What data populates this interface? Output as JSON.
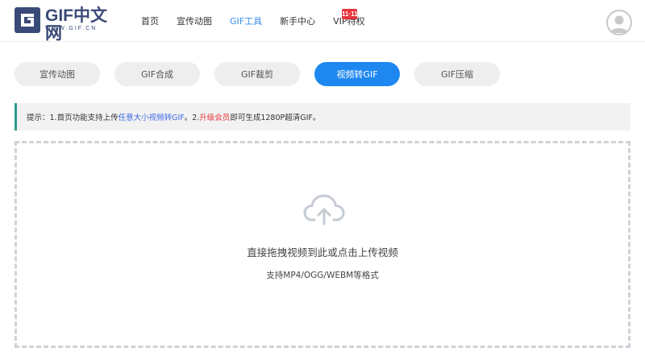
{
  "logo": {
    "text": "GIF中文网",
    "subtext": "WWW.GIF.CN"
  },
  "nav": {
    "items": [
      {
        "label": "首页"
      },
      {
        "label": "宣传动图"
      },
      {
        "label": "GIF工具"
      },
      {
        "label": "新手中心"
      },
      {
        "label": "VIP特权"
      }
    ],
    "active": "GIF工具",
    "badge": "11·11"
  },
  "tabs": [
    {
      "label": "宣传动图"
    },
    {
      "label": "GIF合成"
    },
    {
      "label": "GIF裁剪"
    },
    {
      "label": "视频转GIF"
    },
    {
      "label": "GIF压缩"
    }
  ],
  "notice": {
    "part1": "提示：1.首页功能支持上传",
    "highlight1": "任意大小视频转GIF",
    "part2": "。2.",
    "highlight2": "升级会员",
    "part3": "即可生成1280P超清GIF。"
  },
  "upload": {
    "title": "直接拖拽视频到此或点击上传视频",
    "formats": "支持MP4/OGG/WEBM等格式"
  },
  "colors": {
    "accent": "#1e88f0",
    "nav_active": "#3c8df0",
    "badge": "#e8333b",
    "notice_border": "#2a9d8a",
    "logo": "#3a4a78"
  },
  "icons": {
    "logo": "gif-logo-icon",
    "avatar": "user-avatar-icon",
    "upload": "cloud-upload-icon"
  }
}
